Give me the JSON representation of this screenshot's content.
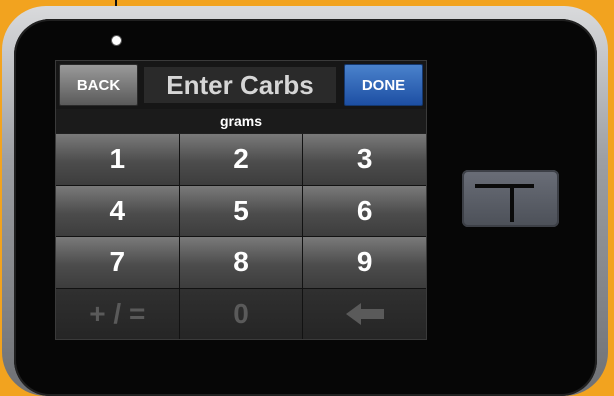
{
  "header": {
    "back_label": "BACK",
    "title": "Enter Carbs",
    "done_label": "DONE"
  },
  "unit_label": "grams",
  "keypad": {
    "keys": [
      "1",
      "2",
      "3",
      "4",
      "5",
      "6",
      "7",
      "8",
      "9",
      "+ / =",
      "0"
    ],
    "backspace_icon": "left-arrow-icon"
  },
  "hardware": {
    "button_icon": "t-logo-icon"
  },
  "colors": {
    "background": "#f2a31f",
    "done_button": "#1d4fa3"
  }
}
